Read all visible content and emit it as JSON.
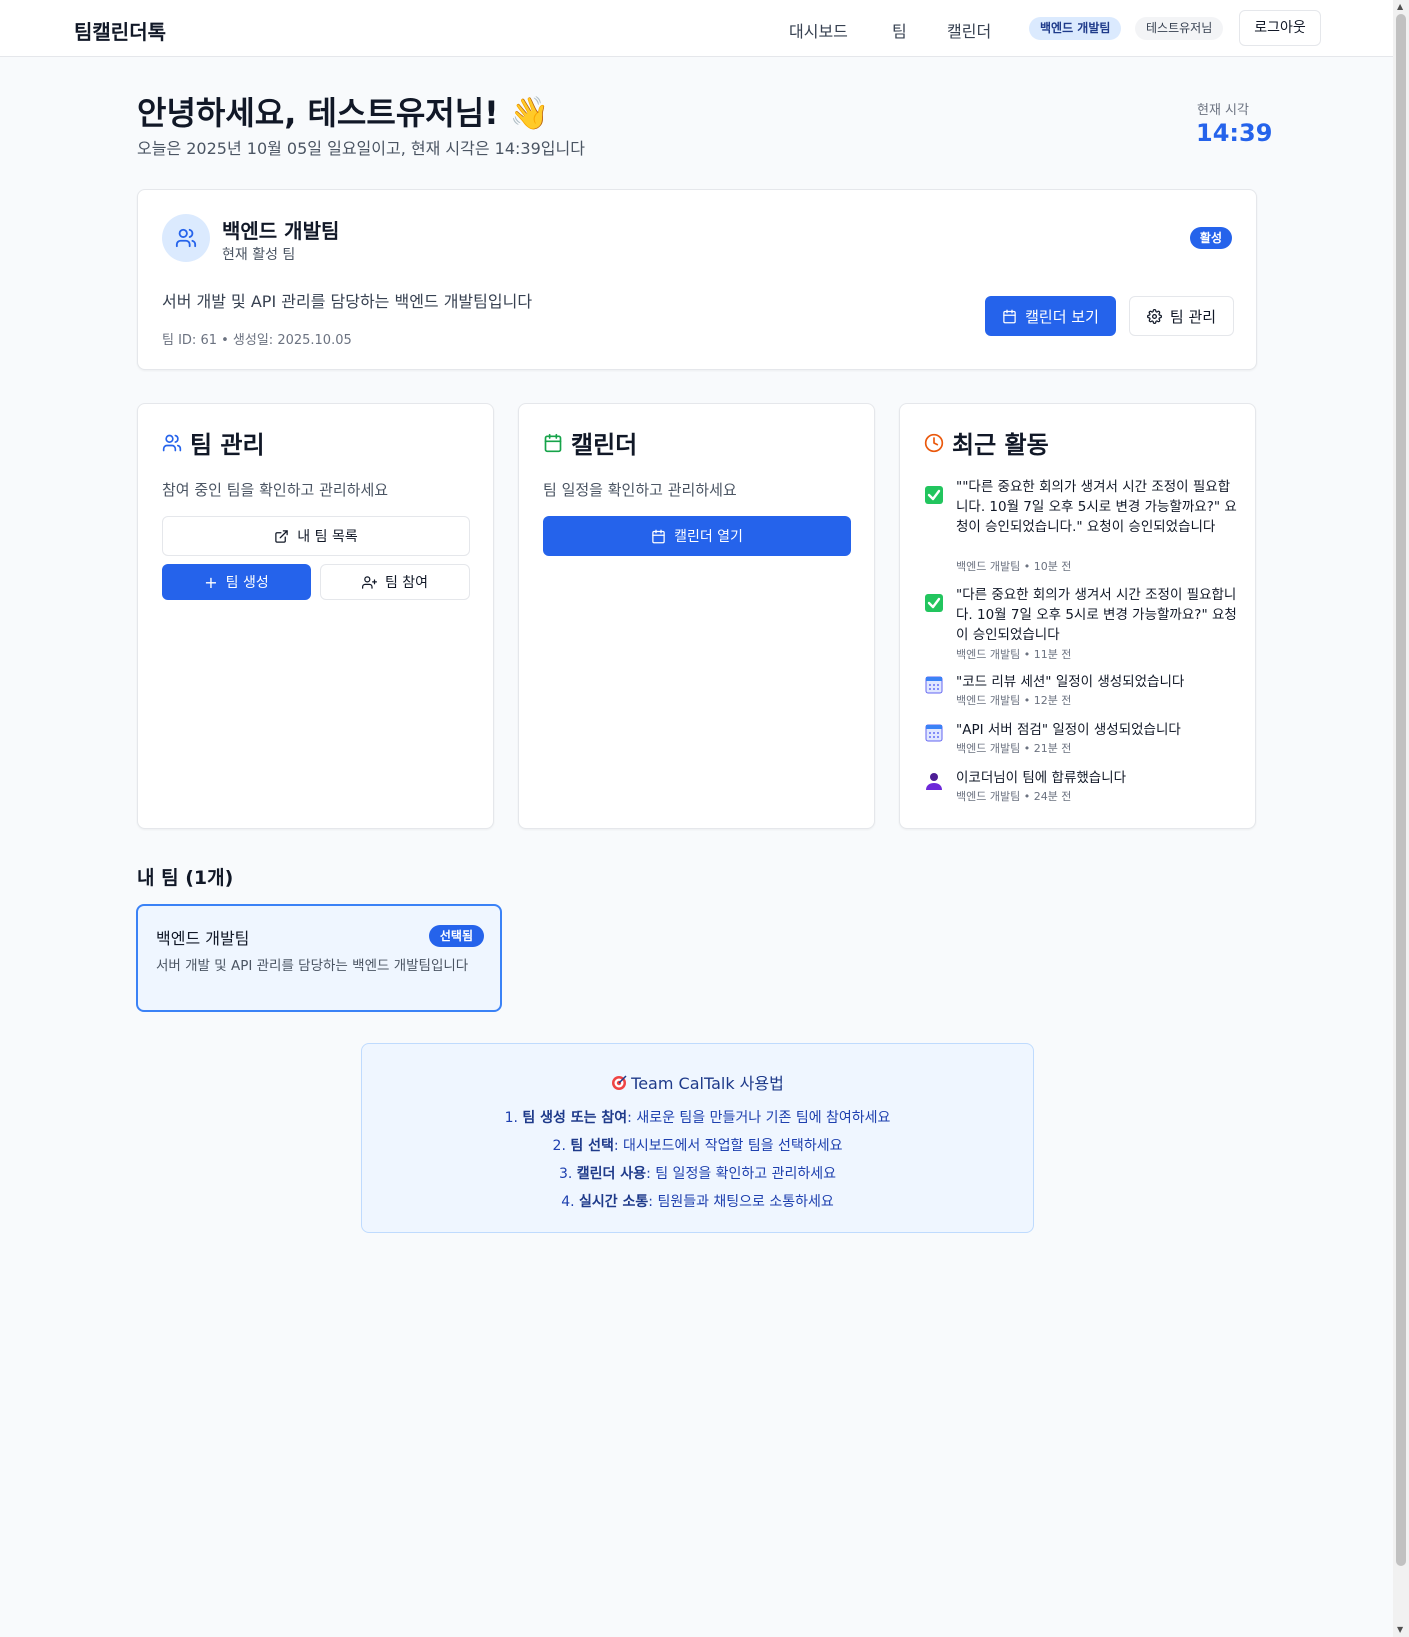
{
  "nav": {
    "brand": "팀캘린더톡",
    "links": [
      "대시보드",
      "팀",
      "캘린더"
    ],
    "current_team": "백엔드 개발팀",
    "user": "테스트유저님",
    "logout": "로그아웃"
  },
  "header": {
    "greeting": "안녕하세요, 테스트유저님! 👋",
    "subtitle": "오늘은 2025년 10월 05일 일요일이고, 현재 시각은 14:39입니다",
    "clock_label": "현재 시각",
    "clock_value": "14:39"
  },
  "active_team": {
    "name": "백엔드 개발팀",
    "subtitle": "현재 활성 팀",
    "badge": "활성",
    "description": "서버 개발 및 API 관리를 담당하는 백엔드 개발팀입니다",
    "meta": "팀 ID: 61 • 생성일: 2025.10.05",
    "calendar_button": "캘린더 보기",
    "manage_button": "팀 관리"
  },
  "team_manage": {
    "title": "팀 관리",
    "description": "참여 중인 팀을 확인하고 관리하세요",
    "my_teams_button": "내 팀 목록",
    "create_button": "팀 생성",
    "join_button": "팀 참여"
  },
  "calendar": {
    "title": "캘린더",
    "description": "팀 일정을 확인하고 관리하세요",
    "open_button": "캘린더 열기"
  },
  "recent": {
    "title": "최근 활동",
    "items": [
      {
        "icon": "check-icon",
        "text": "\"\"다른 중요한 회의가 생겨서 시간 조정이 필요합니다. 10월 7일 오후 5시로 변경 가능할까요?\" 요청이 승인되었습니다.\" 요청이 승인되었습니다",
        "meta": "백엔드 개발팀 • 10분 전"
      },
      {
        "icon": "check-icon",
        "text": "\"다른 중요한 회의가 생겨서 시간 조정이 필요합니다. 10월 7일 오후 5시로 변경 가능할까요?\" 요청이 승인되었습니다",
        "meta": "백엔드 개발팀 • 11분 전"
      },
      {
        "icon": "calendar-icon",
        "text": "\"코드 리뷰 세션\" 일정이 생성되었습니다",
        "meta": "백엔드 개발팀 • 12분 전"
      },
      {
        "icon": "calendar-icon",
        "text": "\"API 서버 점검\" 일정이 생성되었습니다",
        "meta": "백엔드 개발팀 • 21분 전"
      },
      {
        "icon": "person-icon",
        "text": "이코더님이 팀에 합류했습니다",
        "meta": "백엔드 개발팀 • 24분 전"
      }
    ]
  },
  "my_teams": {
    "title": "내 팀 (1개)",
    "items": [
      {
        "name": "백엔드 개발팀",
        "badge": "선택됨",
        "description": "서버 개발 및 API 관리를 담당하는 백엔드 개발팀입니다"
      }
    ]
  },
  "guide": {
    "title": "Team CalTalk 사용법",
    "steps": [
      {
        "num": "1.",
        "bold": "팀 생성 또는 참여",
        "text": ": 새로운 팀을 만들거나 기존 팀에 참여하세요"
      },
      {
        "num": "2.",
        "bold": "팀 선택",
        "text": ": 대시보드에서 작업할 팀을 선택하세요"
      },
      {
        "num": "3.",
        "bold": "캘린더 사용",
        "text": ": 팀 일정을 확인하고 관리하세요"
      },
      {
        "num": "4.",
        "bold": "실시간 소통",
        "text": ": 팀원들과 채팅으로 소통하세요"
      }
    ]
  },
  "colors": {
    "primary": "#2563eb",
    "success": "#16a34a",
    "warning": "#ea580c"
  }
}
